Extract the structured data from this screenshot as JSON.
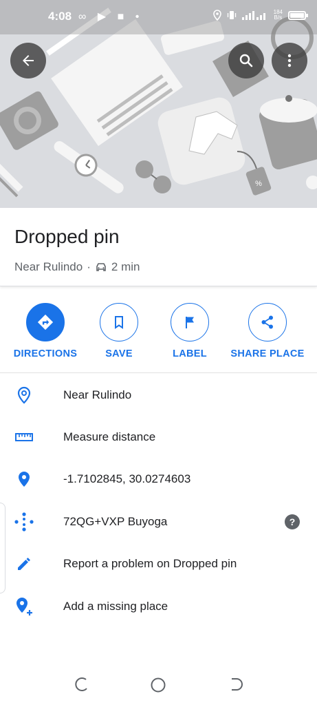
{
  "status_bar": {
    "time": "4:08",
    "left_icons": "∞ ▶ ■ •",
    "speed_top": "184",
    "speed_bottom": "B/s",
    "signal_text": " .ıl ıl"
  },
  "header": {
    "back_icon": "arrow-back-icon",
    "search_icon": "search-icon",
    "more_icon": "more-vert-icon"
  },
  "place": {
    "title": "Dropped pin",
    "location": "Near Rulindo",
    "separator": "·",
    "travel_time": "2 min"
  },
  "actions": [
    {
      "label": "DIRECTIONS",
      "icon": "directions-icon"
    },
    {
      "label": "SAVE",
      "icon": "bookmark-icon"
    },
    {
      "label": "LABEL",
      "icon": "flag-icon"
    },
    {
      "label": "SHARE PLACE",
      "icon": "share-icon"
    }
  ],
  "details": [
    {
      "text": "Near Rulindo",
      "icon": "location-outline-icon"
    },
    {
      "text": "Measure distance",
      "icon": "ruler-icon"
    },
    {
      "text": "-1.7102845, 30.0274603",
      "icon": "pin-icon"
    },
    {
      "text": "72QG+VXP Buyoga",
      "icon": "plus-code-icon",
      "help": "?"
    },
    {
      "text": "Report a problem on Dropped pin",
      "icon": "edit-pencil-icon"
    },
    {
      "text": "Add a missing place",
      "icon": "add-location-icon"
    }
  ],
  "colors": {
    "accent": "#1a73e8",
    "secondary_text": "#5f6368"
  }
}
